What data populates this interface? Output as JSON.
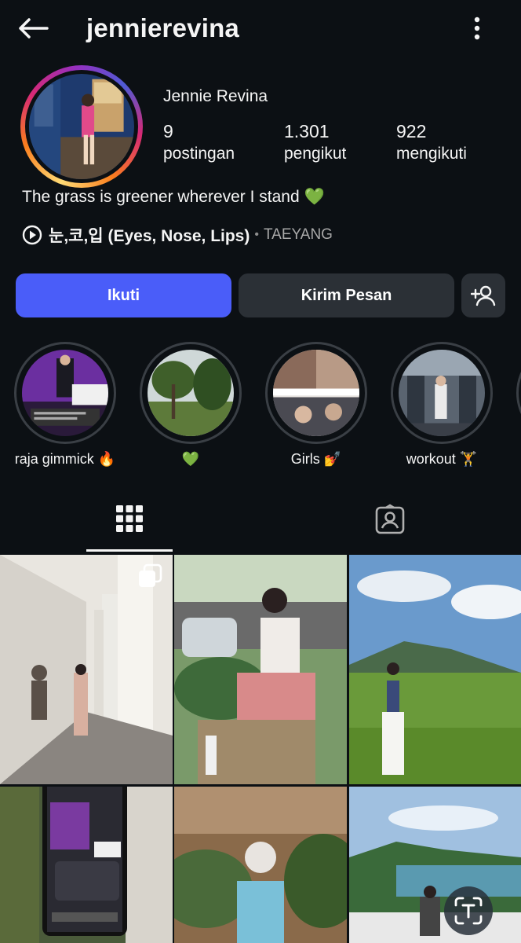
{
  "header": {
    "username": "jennierevina"
  },
  "profile": {
    "display_name": "Jennie Revina",
    "stats": [
      {
        "value": "9",
        "label": "postingan"
      },
      {
        "value": "1.301",
        "label": "pengikut"
      },
      {
        "value": "922",
        "label": "mengikuti"
      }
    ],
    "bio": "The grass is greener wherever I stand 💚",
    "music": {
      "song": "눈,코,입 (Eyes, Nose, Lips)",
      "separator": "•",
      "artist": "TAEYANG"
    }
  },
  "actions": {
    "follow_label": "Ikuti",
    "message_label": "Kirim Pesan"
  },
  "highlights": [
    {
      "label": "raja gimmick 🔥"
    },
    {
      "label": "💚"
    },
    {
      "label": "Girls 💅"
    },
    {
      "label": "workout 🏋️"
    }
  ],
  "colors": {
    "accent": "#4a5df9",
    "background": "#0c1014",
    "secondary_button": "#2b3036"
  }
}
